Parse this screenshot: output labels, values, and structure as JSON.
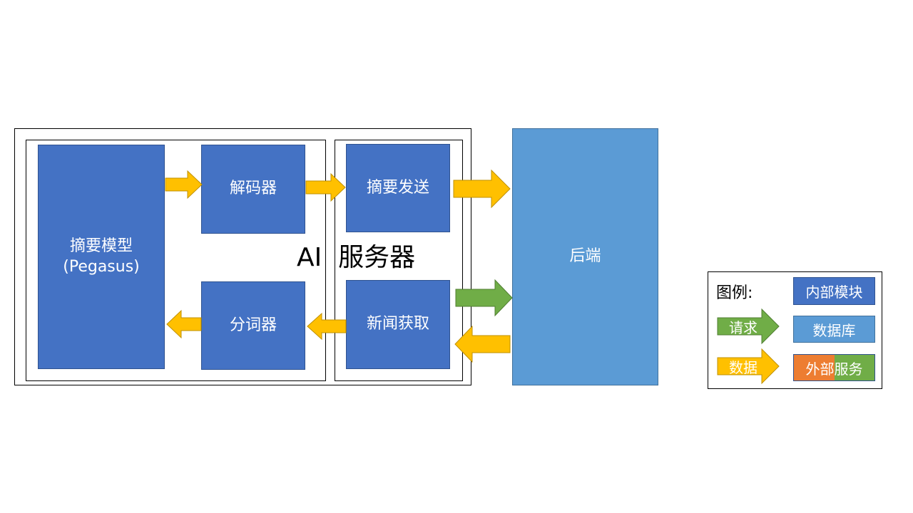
{
  "colors": {
    "module": "#4472c4",
    "database": "#5b9bd5",
    "request_arrow": "#70ad47",
    "data_arrow": "#ffc000",
    "external_left": "#ed7d31",
    "external_right": "#70ad47"
  },
  "diagram": {
    "server_title": "AI  服务器",
    "modules": {
      "summary_model_line1": "摘要模型",
      "summary_model_line2": "(Pegasus)",
      "decoder": "解码器",
      "tokenizer": "分词器",
      "summary_send": "摘要发送",
      "news_fetch": "新闻获取"
    },
    "backend": "后端"
  },
  "legend": {
    "title": "图例:",
    "request": "请求",
    "data": "数据",
    "internal_module": "内部模块",
    "database": "数据库",
    "external_service": "外部服务"
  }
}
